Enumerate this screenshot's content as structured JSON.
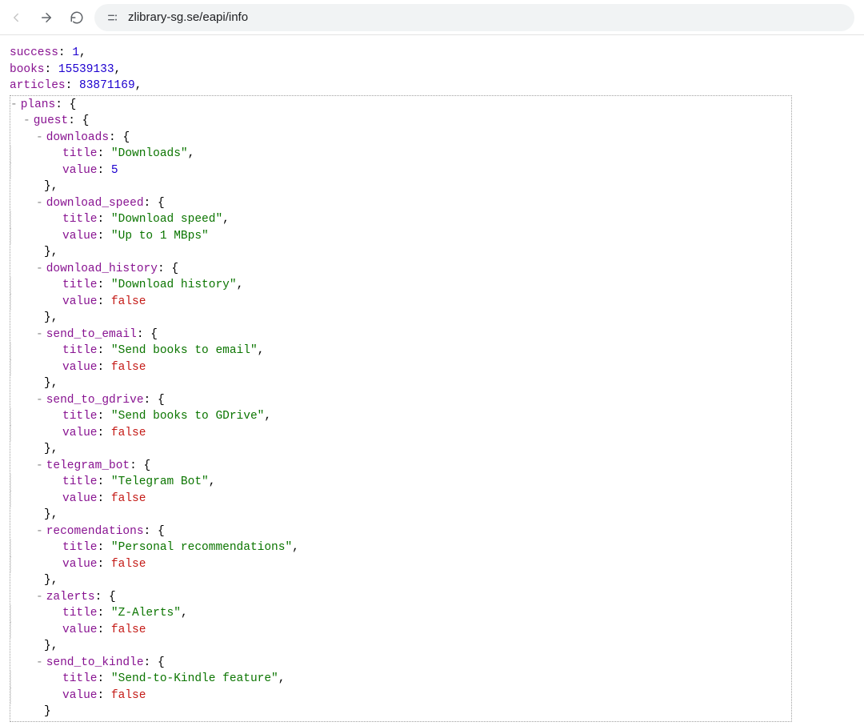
{
  "browser": {
    "url": "zlibrary-sg.se/eapi/info"
  },
  "json": {
    "success": 1,
    "books": 15539133,
    "articles": 83871169,
    "plans_key": "plans",
    "guest_key": "guest",
    "guest": [
      {
        "pkey": "downloads",
        "title": "Downloads",
        "value": 5
      },
      {
        "pkey": "download_speed",
        "title": "Download speed",
        "value": "Up to 1 MBps"
      },
      {
        "pkey": "download_history",
        "title": "Download history",
        "value": false
      },
      {
        "pkey": "send_to_email",
        "title": "Send books to email",
        "value": false
      },
      {
        "pkey": "send_to_gdrive",
        "title": "Send books to GDrive",
        "value": false
      },
      {
        "pkey": "telegram_bot",
        "title": "Telegram Bot",
        "value": false
      },
      {
        "pkey": "recomendations",
        "title": "Personal recommendations",
        "value": false
      },
      {
        "pkey": "zalerts",
        "title": "Z-Alerts",
        "value": false
      },
      {
        "pkey": "send_to_kindle",
        "title": "Send-to-Kindle feature",
        "value": false
      }
    ],
    "labels": {
      "title": "title",
      "value": "value"
    }
  }
}
